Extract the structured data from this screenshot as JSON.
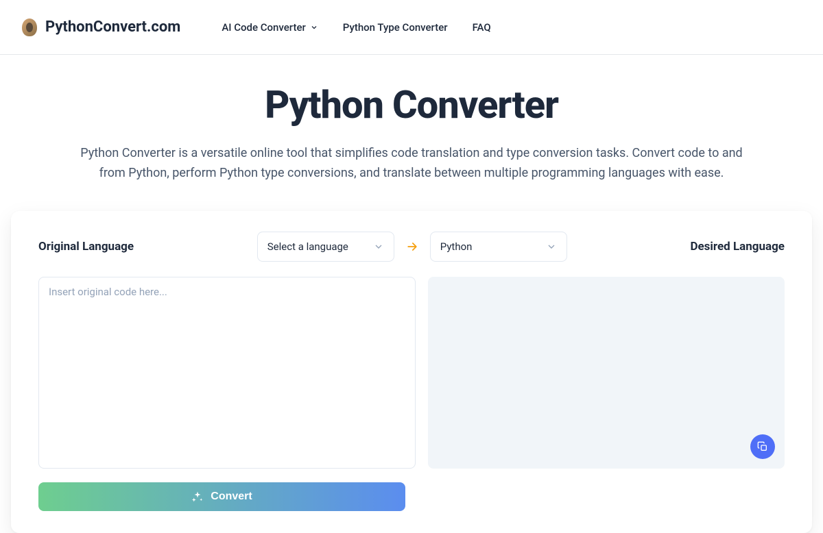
{
  "header": {
    "site_title": "PythonConvert.com",
    "nav": {
      "ai_converter": "AI Code Converter",
      "type_converter": "Python Type Converter",
      "faq": "FAQ"
    }
  },
  "main": {
    "title": "Python Converter",
    "description": "Python Converter is a versatile online tool that simplifies code translation and type conversion tasks. Convert code to and from Python, perform Python type conversions, and translate between multiple programming languages with ease."
  },
  "converter": {
    "original_label": "Original Language",
    "desired_label": "Desired Language",
    "source_select": "Select a language",
    "target_select": "Python",
    "input_placeholder": "Insert original code here...",
    "convert_button": "Convert"
  }
}
